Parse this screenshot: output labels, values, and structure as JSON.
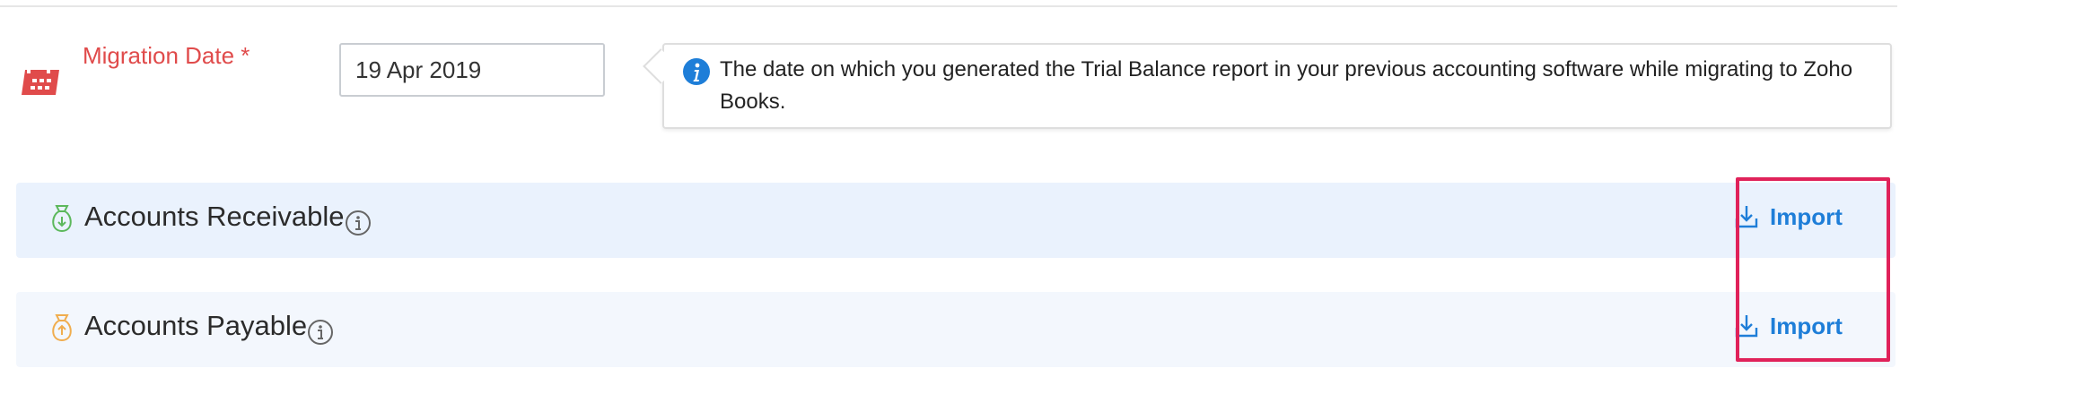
{
  "migration": {
    "label": "Migration Date *",
    "date_value": "19 Apr 2019",
    "info_text": "The date on which you generated the Trial Balance report in your previous accounting software while migrating to Zoho Books."
  },
  "sections": [
    {
      "title": "Accounts Receivable",
      "import_label": "Import",
      "icon": "money-bag-down-icon"
    },
    {
      "title": "Accounts Payable",
      "import_label": "Import",
      "icon": "money-bag-up-icon"
    }
  ],
  "colors": {
    "required_label": "#e04b4b",
    "link": "#1e7ed8",
    "highlight": "#e0225a",
    "receivable_icon": "#5cb85c",
    "payable_icon": "#f0ad4e"
  }
}
